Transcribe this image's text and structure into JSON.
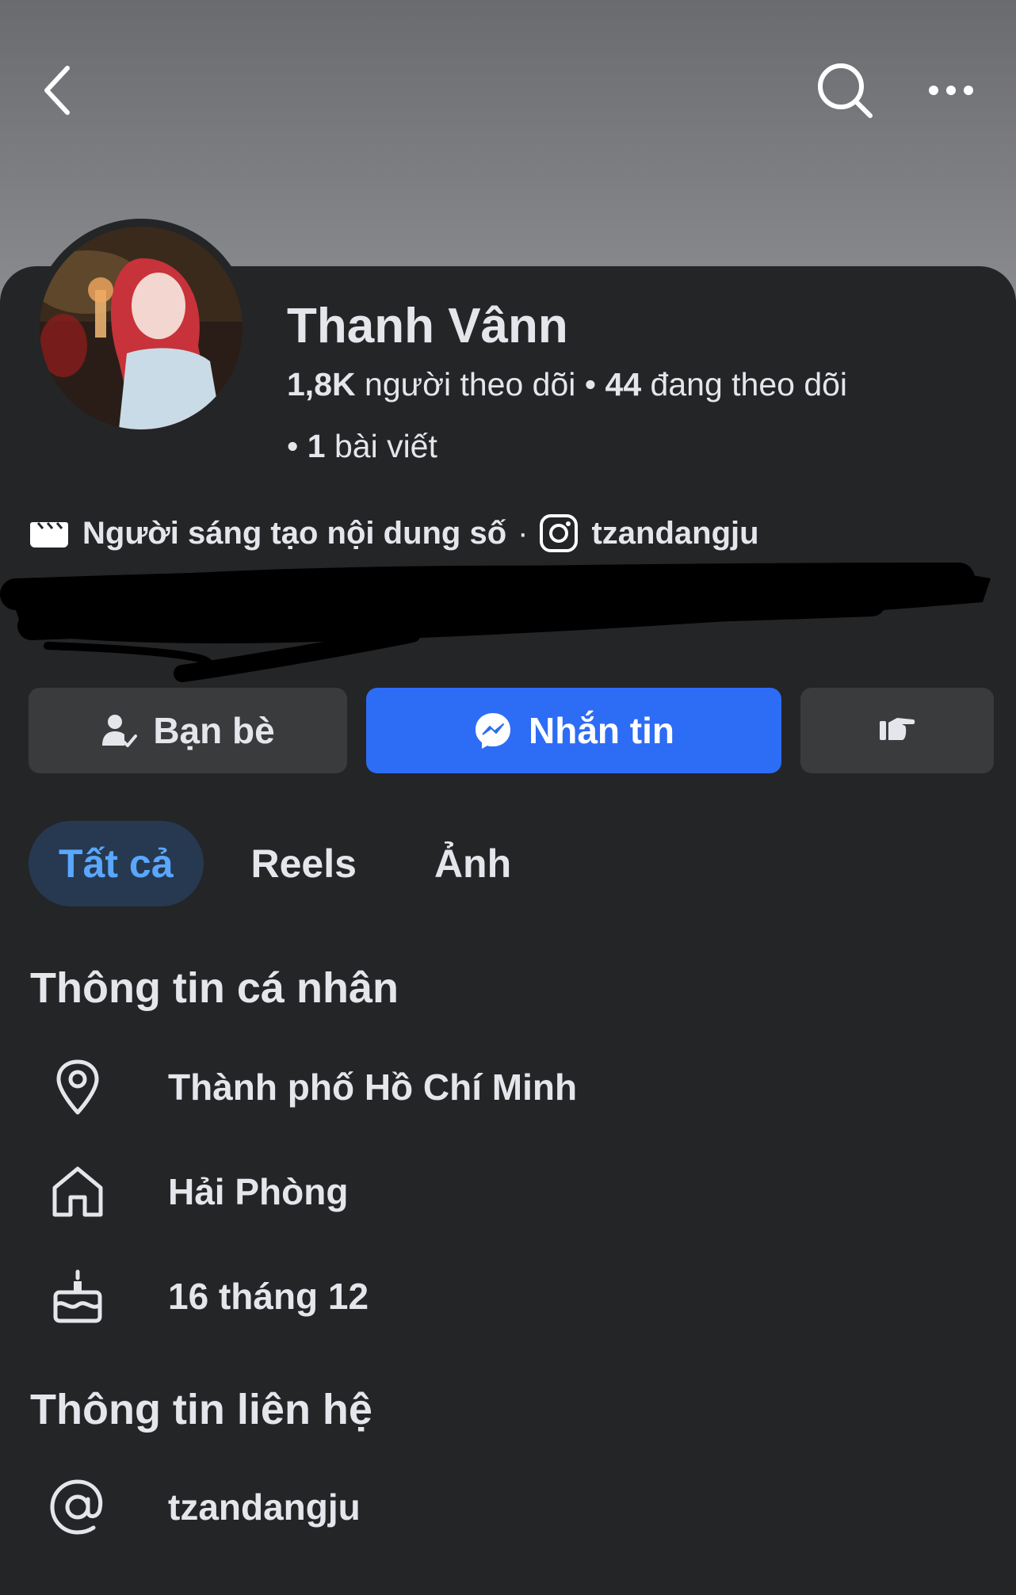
{
  "header": {
    "back_icon": "chevron-left-icon",
    "search_icon": "search-icon",
    "more_icon": "more-horizontal-icon"
  },
  "profile": {
    "name": "Thanh Vânn",
    "followers_count": "1,8K",
    "followers_label": "người theo dõi",
    "following_count": "44",
    "following_label": "đang theo dõi",
    "posts_count": "1",
    "posts_label": "bài viết",
    "category": "Người sáng tạo nội dung số",
    "instagram_handle": "tzandangju"
  },
  "actions": {
    "friends_label": "Bạn bè",
    "message_label": "Nhắn tin",
    "more_icon": "poke-hand-icon"
  },
  "tabs": [
    {
      "label": "Tất cả",
      "active": true
    },
    {
      "label": "Reels",
      "active": false
    },
    {
      "label": "Ảnh",
      "active": false
    }
  ],
  "personal_info": {
    "title": "Thông tin cá nhân",
    "items": [
      {
        "icon": "location-pin-icon",
        "text": "Thành phố Hồ Chí Minh"
      },
      {
        "icon": "home-icon",
        "text": "Hải Phòng"
      },
      {
        "icon": "birthday-cake-icon",
        "text": "16 tháng 12"
      }
    ]
  },
  "contact_info": {
    "title": "Thông tin liên hệ",
    "items": [
      {
        "icon": "at-sign-icon",
        "text": "tzandangju"
      }
    ]
  },
  "colors": {
    "background": "#242527",
    "primary_button": "#2d6cf5",
    "secondary_button": "#3a3b3d",
    "active_tab_bg": "#263951",
    "active_tab_text": "#5aa7ff",
    "text": "#e4e6eb"
  }
}
